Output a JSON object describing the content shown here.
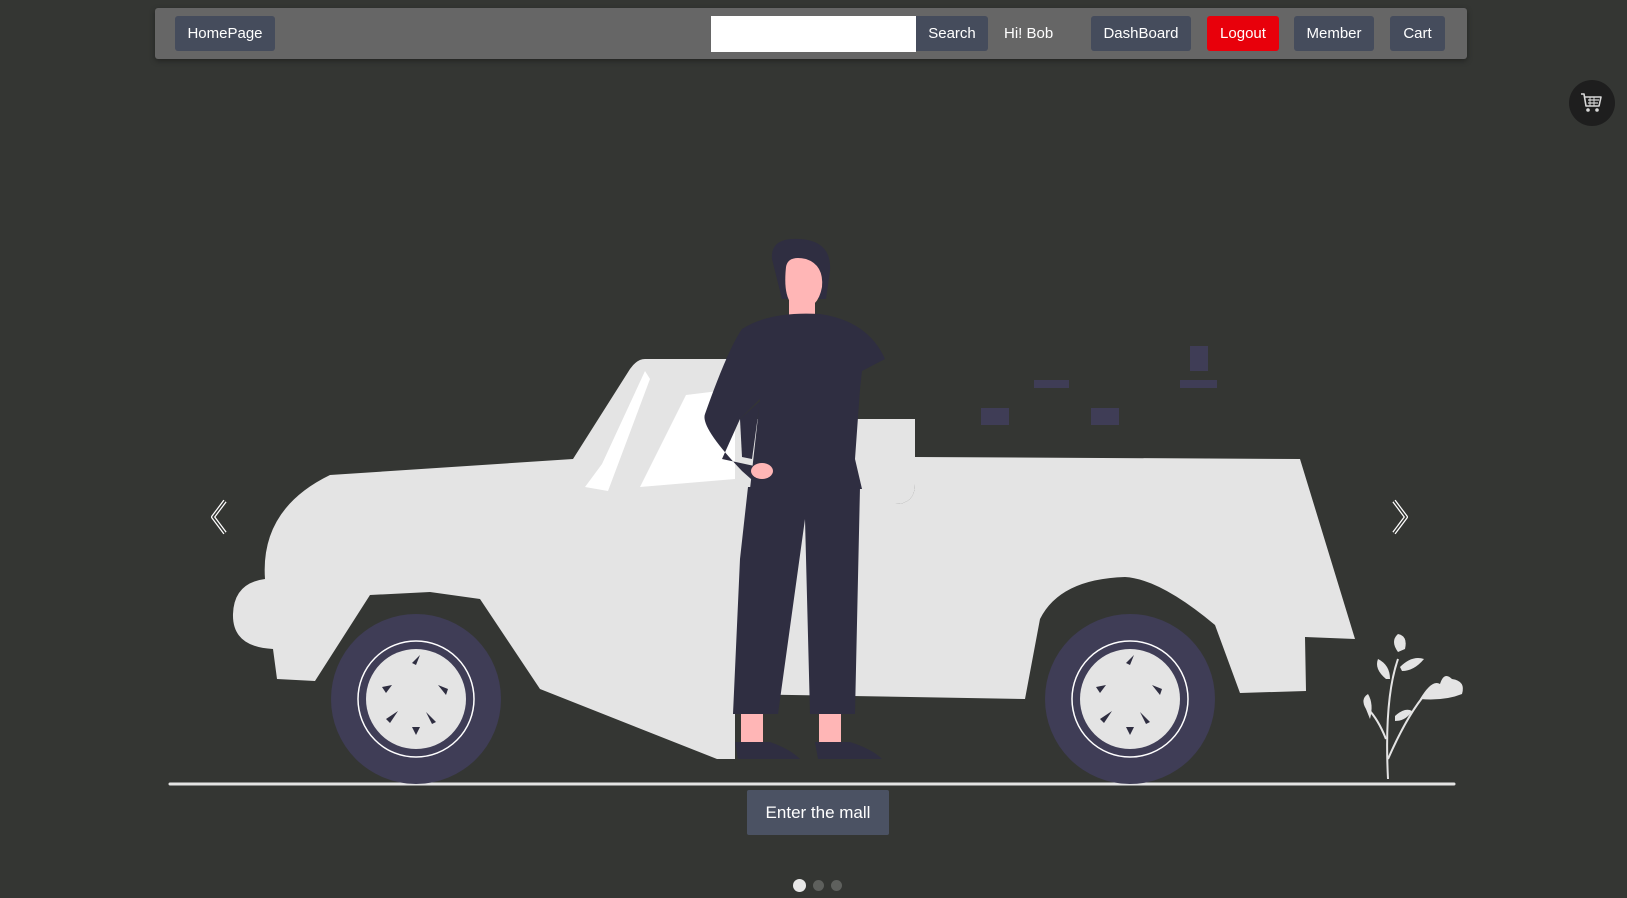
{
  "navbar": {
    "home_label": "HomePage",
    "search": {
      "value": "",
      "placeholder": ""
    },
    "search_button_label": "Search",
    "greeting": "Hi! Bob",
    "dashboard_label": "DashBoard",
    "logout_label": "Logout",
    "member_label": "Member",
    "cart_label": "Cart"
  },
  "floating_cart": {
    "icon": "shopping-cart-icon"
  },
  "carousel": {
    "prev_icon": "chevron-left-icon",
    "next_icon": "chevron-right-icon",
    "cta_label": "Enter the mall",
    "slide_count": 3,
    "active_slide": 1
  },
  "colors": {
    "page_background": "#343633",
    "navbar_background": "#666666",
    "button_background": "#454c5c",
    "logout_background": "#e8000b",
    "car_body": "#e4e4e4",
    "person_clothes": "#2f2e41",
    "tire": "#3f3d56",
    "skin": "#ffb6b6"
  }
}
